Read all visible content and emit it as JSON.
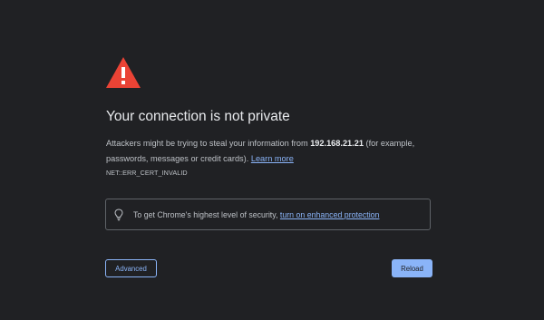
{
  "interstitial": {
    "title": "Your connection is not private",
    "message_before": "Attackers might be trying to steal your information from ",
    "host": "192.168.21.21",
    "message_after": " (for example, passwords, messages or credit cards). ",
    "learn_more": "Learn more",
    "error_code": "NET::ERR_CERT_INVALID",
    "protection_text": "To get Chrome's highest level of security, ",
    "protection_link": "turn on enhanced protection",
    "advanced_label": "Advanced",
    "reload_label": "Reload"
  },
  "icons": {
    "warning": "warning-triangle-icon",
    "bulb": "lightbulb-icon"
  },
  "colors": {
    "background": "#202124",
    "warning_red": "#ea4335",
    "link_blue": "#8ab4f8",
    "title_text": "#e8eaed",
    "body_text": "#bdc1c6"
  }
}
